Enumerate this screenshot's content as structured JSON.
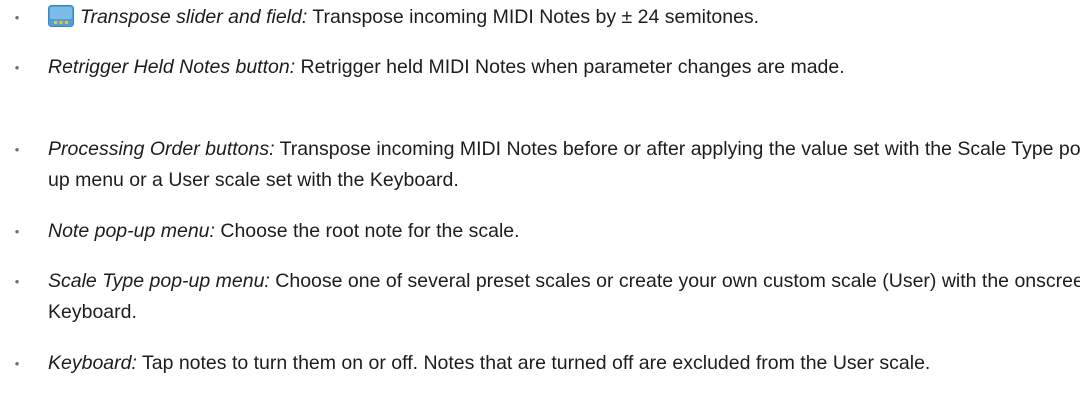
{
  "bullet_char": "•",
  "icon": {
    "name": "transpose-widget-icon",
    "color": "#4f9fd9",
    "accent": "#f2c230"
  },
  "items": [
    {
      "term": "Transpose slider and field:",
      "text": " Transpose incoming MIDI Notes by ± 24 semitones."
    },
    {
      "term": "Retrigger Held Notes button:",
      "text": " Retrigger held MIDI Notes when parameter changes are made."
    },
    {
      "term": "Processing Order buttons:",
      "text": " Transpose incoming MIDI Notes before or after applying the value set with the Scale Type pop-up menu or a User scale set with the Keyboard."
    },
    {
      "term": "Note pop-up menu:",
      "text": " Choose the root note for the scale."
    },
    {
      "term": "Scale Type pop-up menu:",
      "text": " Choose one of several preset scales or create your own custom scale (User) with the onscreen Keyboard."
    },
    {
      "term": "Keyboard:",
      "text": " Tap notes to turn them on or off. Notes that are turned off are excluded from the User scale."
    }
  ]
}
